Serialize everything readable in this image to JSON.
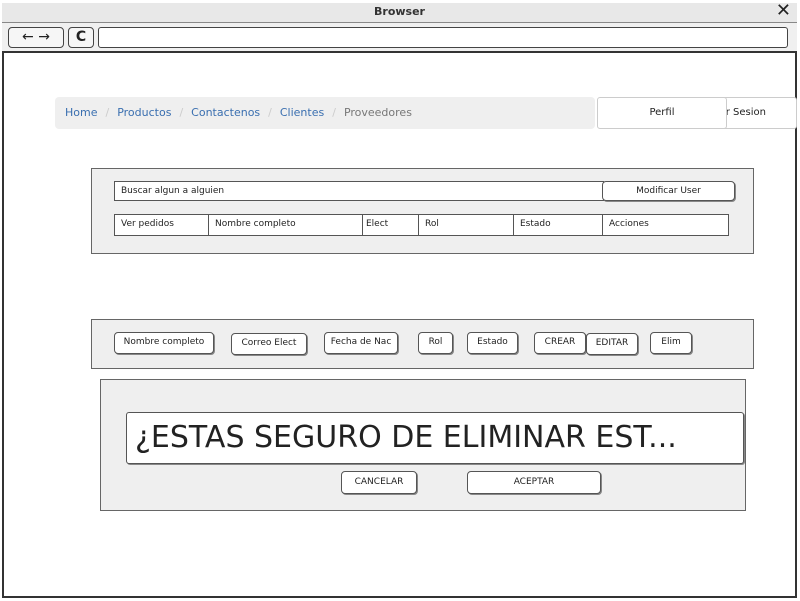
{
  "window": {
    "title": "Browser",
    "close_glyph": "✕"
  },
  "toolbar": {
    "back": "←",
    "forward": "→",
    "reload": "C",
    "url": ""
  },
  "nav": {
    "crumbs": [
      "Home",
      "Productos",
      "Contactenos",
      "Clientes",
      "Proveedores"
    ],
    "separator": "/",
    "perfil": "Perfil",
    "cerrar_sesion": "r Sesion"
  },
  "search": {
    "value": "Buscar algun a alguien",
    "modify_button": "Modificar User"
  },
  "table_header": [
    "Ver pedidos",
    "Nombre completo",
    "Elect",
    "Rol",
    "Estado",
    "Acciones"
  ],
  "form_buttons": [
    "Nombre completo",
    "Correo Elect",
    "Fecha de Nac",
    "Rol",
    "Estado",
    "CREAR",
    "EDITAR",
    "Elim"
  ],
  "dialog": {
    "message": "¿ESTAS SEGURO DE ELIMINAR EST...",
    "cancel": "CANCELAR",
    "accept": "ACEPTAR"
  }
}
